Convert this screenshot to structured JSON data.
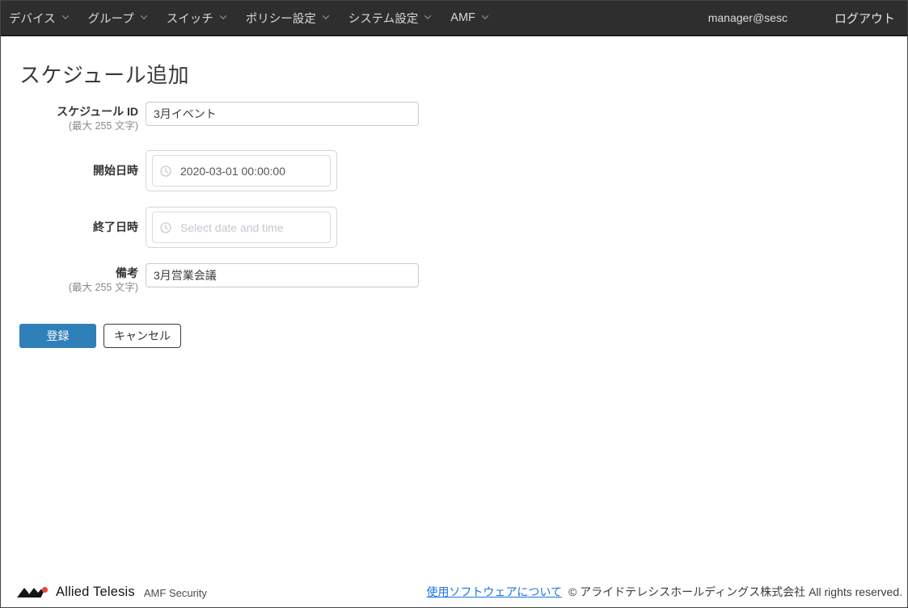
{
  "navbar": {
    "items": [
      {
        "label": "デバイス"
      },
      {
        "label": "グループ"
      },
      {
        "label": "スイッチ"
      },
      {
        "label": "ポリシー設定"
      },
      {
        "label": "システム設定"
      },
      {
        "label": "AMF"
      }
    ],
    "user": "manager@sesc",
    "logout_label": "ログアウト"
  },
  "page": {
    "title": "スケジュール追加"
  },
  "form": {
    "schedule_id": {
      "label": "スケジュール ID",
      "hint": "(最大 255 文字)",
      "value": "3月イベント"
    },
    "start_datetime": {
      "label": "開始日時",
      "value": "2020-03-01 00:00:00"
    },
    "end_datetime": {
      "label": "終了日時",
      "placeholder": "Select date and time"
    },
    "remarks": {
      "label": "備考",
      "hint": "(最大 255 文字)",
      "value": "3月営業会議"
    },
    "submit_label": "登録",
    "cancel_label": "キャンセル"
  },
  "footer": {
    "brand": "Allied Telesis",
    "product": "AMF Security",
    "software_link": "使用ソフトウェアについて",
    "copyright": "© アライドテレシスホールディングス株式会社 All rights reserved."
  },
  "colors": {
    "navbar_bg": "#2e2e2e",
    "primary_button": "#2f80b9",
    "link_blue": "#1a73e8",
    "logo_red": "#e8453c"
  }
}
